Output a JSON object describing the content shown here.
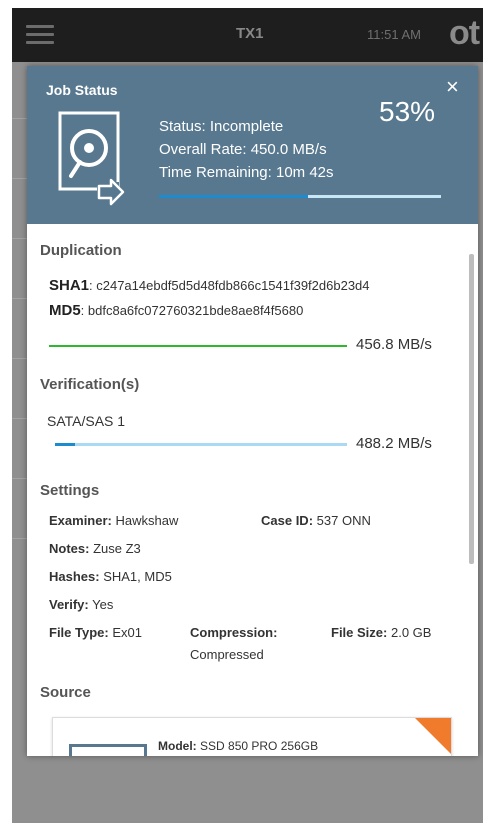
{
  "app_bar": {
    "title": "TX1",
    "time": "11:51 AM",
    "logo": "ot"
  },
  "modal": {
    "title": "Job Status",
    "close_label": "×",
    "percent": "53%",
    "progress": 0.53,
    "status": "Status: Incomplete",
    "overall_rate": "Overall Rate: 450.0 MB/s",
    "time_remaining": "Time Remaining: 10m 42s"
  },
  "duplication": {
    "heading": "Duplication",
    "sha1_label": "SHA1",
    "sha1_value": ": c247a14ebdf5d5d48fdb866c1541f39f2d6b23d4",
    "md5_label": "MD5",
    "md5_value": ": bdfc8a6fc072760321bde8ae8f4f5680",
    "rate": "456.8 MB/s",
    "progress": 1.0
  },
  "verification": {
    "heading": "Verification(s)",
    "target": "SATA/SAS 1",
    "rate": "488.2 MB/s",
    "progress": 0.07
  },
  "settings": {
    "heading": "Settings",
    "examiner_label": "Examiner:",
    "examiner": "Hawkshaw",
    "case_id_label": "Case ID:",
    "case_id": "537 ONN",
    "notes_label": "Notes:",
    "notes": "Zuse Z3",
    "hashes_label": "Hashes:",
    "hashes": "SHA1, MD5",
    "verify_label": "Verify:",
    "verify": "Yes",
    "file_type_label": "File Type:",
    "file_type": "Ex01",
    "compression_label": "Compression:",
    "compression": "Compressed",
    "file_size_label": "File Size:",
    "file_size": "2.0 GB"
  },
  "source": {
    "heading": "Source",
    "model_label": "Model:",
    "model": "SSD 850 PRO 256GB"
  },
  "colors": {
    "header_bg": "#58788f",
    "progress_blue": "#1d8bcf",
    "dup_green": "#2db82d",
    "verify_light": "#a9d9f3",
    "accent_orange": "#f07b2d"
  }
}
